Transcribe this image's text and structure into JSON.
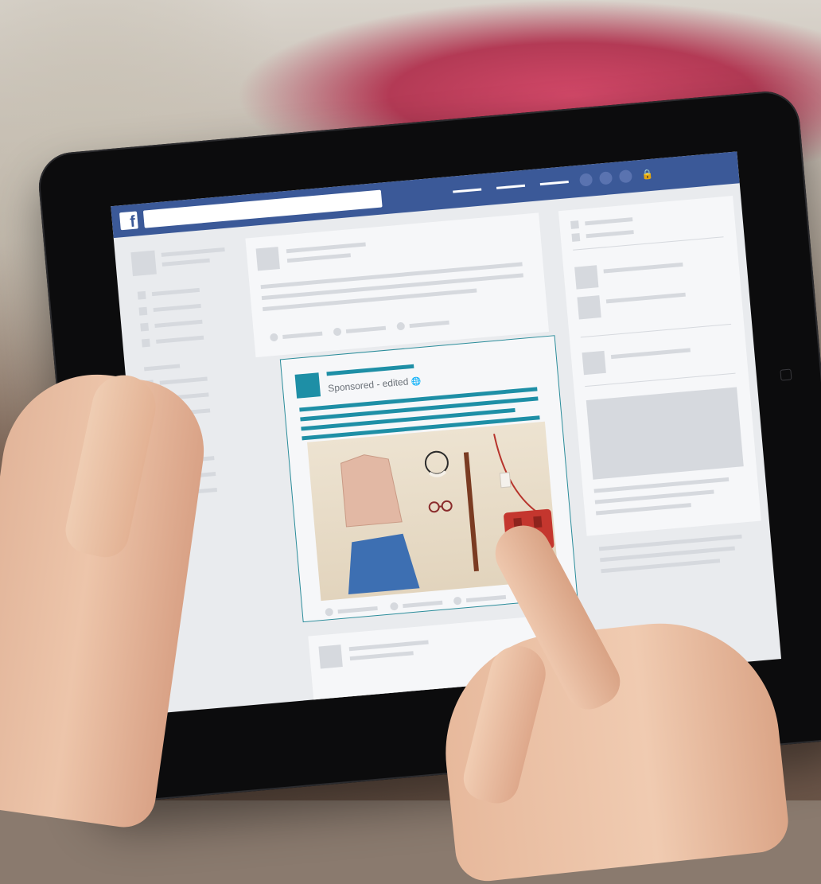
{
  "facebook_ui": {
    "logo_letter": "f",
    "ad_post": {
      "sponsored_label": "Sponsored - edited",
      "globe_icon": "globe-icon"
    }
  },
  "colors": {
    "facebook_blue": "#3b5998",
    "ad_accent_teal": "#1e8fa6",
    "awning_red": "#c83a5a"
  }
}
